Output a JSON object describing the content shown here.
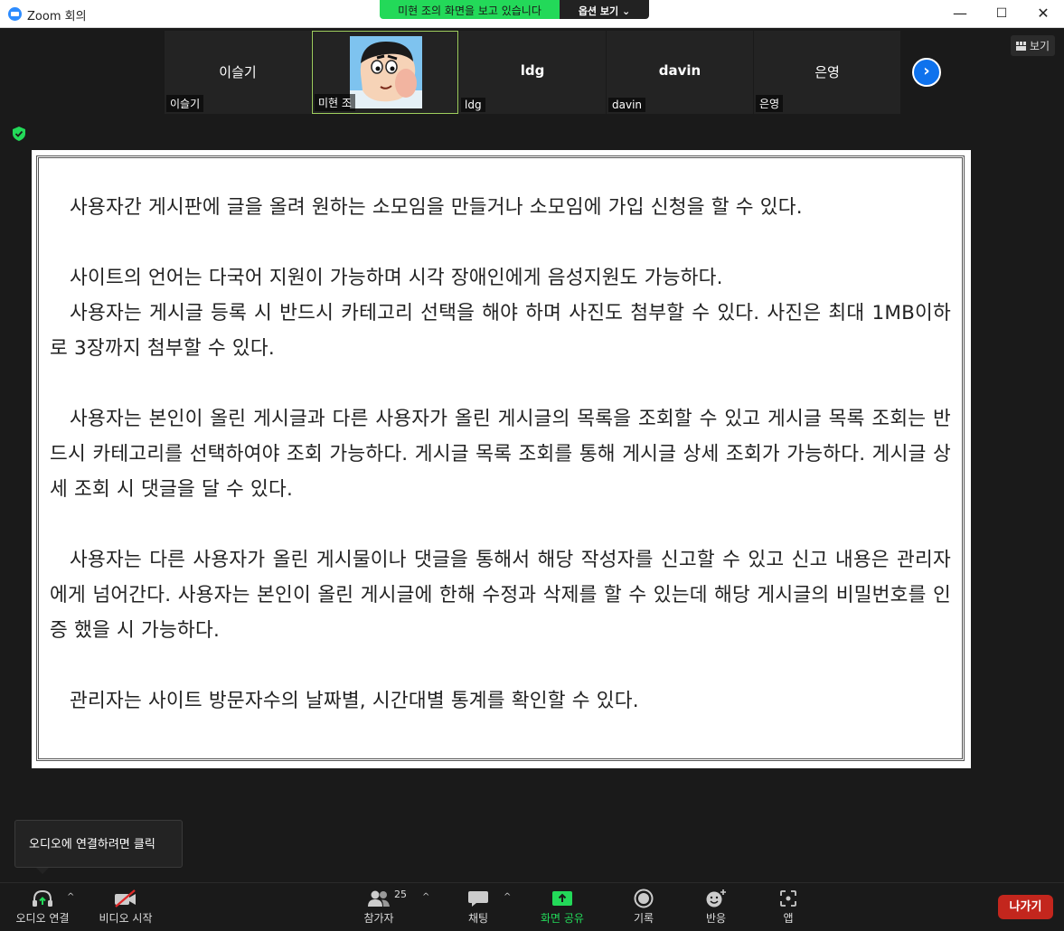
{
  "window": {
    "title": "Zoom 회의",
    "minimize": "—",
    "maximize": "☐",
    "close": "✕"
  },
  "share_banner": {
    "status": "미현 조의 화면을 보고 있습니다",
    "options": "옵션 보기 ⌄"
  },
  "gallery": {
    "view_label": "보기",
    "participants": [
      {
        "center_name": "이슬기",
        "label": "이슬기"
      },
      {
        "center_name": "",
        "label": "미현 조"
      },
      {
        "center_name": "ldg",
        "label": "ldg"
      },
      {
        "center_name": "davin",
        "label": "davin"
      },
      {
        "center_name": "은영",
        "label": "은영"
      }
    ]
  },
  "document": {
    "paragraphs": [
      "사용자간 게시판에 글을 올려 원하는 소모임을 만들거나 소모임에 가입 신청을 할 수 있다.",
      "사이트의 언어는 다국어 지원이 가능하며 시각 장애인에게 음성지원도 가능하다.",
      "사용자는 게시글 등록 시 반드시 카테고리 선택을 해야 하며 사진도 첨부할 수 있다. 사진은 최대 1MB이하로 3장까지 첨부할 수 있다.",
      "사용자는 본인이 올린 게시글과 다른 사용자가 올린 게시글의 목록을 조회할 수 있고 게시글 목록 조회는 반드시 카테고리를 선택하여야 조회 가능하다. 게시글 목록 조회를 통해 게시글 상세 조회가 가능하다. 게시글 상세 조회 시 댓글을 달 수 있다.",
      "사용자는 다른 사용자가 올린 게시물이나 댓글을 통해서 해당 작성자를 신고할 수 있고 신고 내용은 관리자에게 넘어간다. 사용자는 본인이 올린 게시글에 한해 수정과 삭제를 할 수 있는데 해당 게시글의 비밀번호를 인증 했을 시 가능하다.",
      "관리자는 사이트 방문자수의 날짜별, 시간대별 통계를 확인할 수 있다."
    ]
  },
  "tooltip": {
    "text": "오디오에 연결하려면 클릭"
  },
  "toolbar": {
    "audio": "오디오 연결",
    "video": "비디오 시작",
    "participants": "참가자",
    "participants_count": "25",
    "chat": "채팅",
    "share": "화면 공유",
    "record": "기록",
    "reactions": "반응",
    "apps": "앱",
    "leave": "나가기",
    "accent_green": "#23d959",
    "leave_color": "#c3261d"
  }
}
